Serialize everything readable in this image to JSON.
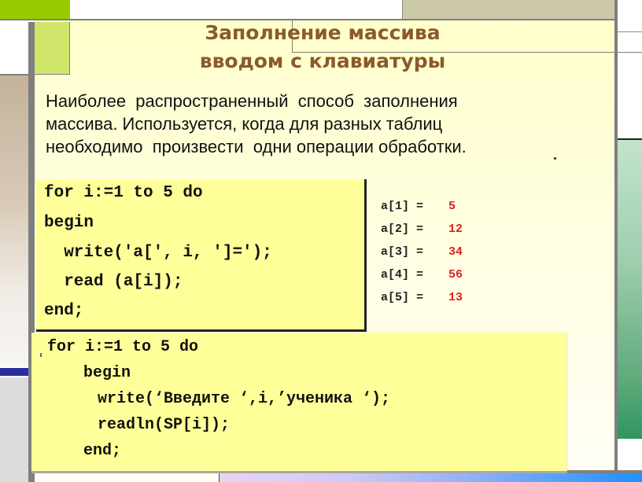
{
  "slide": {
    "title_line1": "Заполнение массива",
    "title_line2": "вводом с клавиатуры",
    "description_lines": [
      "Наиболее  распространенный  способ  заполнения",
      "массива. Используется, когда для разных таблиц",
      "необходимо  произвести  одни операции обработки."
    ]
  },
  "code_example_1": {
    "lines": [
      "for i:=1 to 5 do",
      "begin",
      "  write('a[', i, ']=');",
      "  read (a[i]);",
      "end;"
    ]
  },
  "program_output": {
    "rows": [
      {
        "label": "a[1] =",
        "value": "5"
      },
      {
        "label": "a[2] =",
        "value": "12"
      },
      {
        "label": "a[3] =",
        "value": "34"
      },
      {
        "label": "a[4] =",
        "value": "56"
      },
      {
        "label": "a[5] =",
        "value": "13"
      }
    ],
    "value_color": "#e02020"
  },
  "code_example_2": {
    "lines": [
      "for i:=1 to 5 do",
      "begin",
      "write(‘Введите ‘,i,’ученика ‘);",
      "readln(SP[i]);",
      "end;"
    ]
  },
  "colors": {
    "title": "#8b5a2b",
    "code_background": "#ffff99",
    "slide_background": "#ffffcc",
    "accent_green": "#99cc00"
  }
}
